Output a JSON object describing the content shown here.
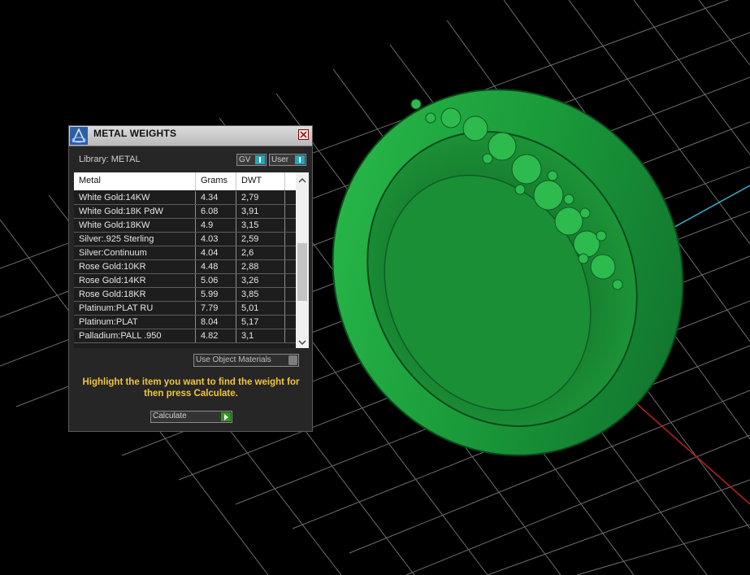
{
  "window": {
    "title": "METAL WEIGHTS",
    "library_label": "Library: METAL",
    "toggles": {
      "gv": "GV",
      "user": "User"
    },
    "accent_color": "#27a6b7"
  },
  "table": {
    "headers": [
      "Metal",
      "Grams",
      "DWT"
    ],
    "rows": [
      {
        "metal": "White Gold:14KW",
        "grams": "4.34",
        "dwt": "2,79"
      },
      {
        "metal": "White Gold:18K PdW",
        "grams": "6.08",
        "dwt": "3,91"
      },
      {
        "metal": "White Gold:18KW",
        "grams": "4.9",
        "dwt": "3,15"
      },
      {
        "metal": "Silver:.925 Sterling",
        "grams": "4.03",
        "dwt": "2,59"
      },
      {
        "metal": "Silver:Continuum",
        "grams": "4.04",
        "dwt": "2,6"
      },
      {
        "metal": "Rose Gold:10KR",
        "grams": "4.48",
        "dwt": "2,88"
      },
      {
        "metal": "Rose Gold:14KR",
        "grams": "5.06",
        "dwt": "3,26"
      },
      {
        "metal": "Rose Gold:18KR",
        "grams": "5.99",
        "dwt": "3,85"
      },
      {
        "metal": "Platinum:PLAT RU",
        "grams": "7.79",
        "dwt": "5,01"
      },
      {
        "metal": "Platinum:PLAT",
        "grams": "8.04",
        "dwt": "5,17"
      },
      {
        "metal": "Palladium:PALL .950",
        "grams": "4.82",
        "dwt": "3,1"
      }
    ]
  },
  "use_object_materials_label": "Use Object Materials",
  "instructions": "Highlight the item you want to find the weight for then press Calculate.",
  "calculate_label": "Calculate",
  "viewport": {
    "model_color": "#1e9a3a",
    "grid_color": "#8a8a8a"
  }
}
